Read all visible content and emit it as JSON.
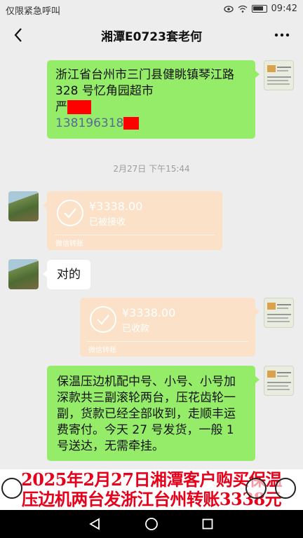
{
  "status_bar": {
    "carrier_text": "仅限紧急呼叫",
    "time": "09:42"
  },
  "header": {
    "title": "湘潭E0723套老何"
  },
  "messages": {
    "address": {
      "line1": "浙江省台州市三门县健眺镇琴江路",
      "line2": "328 号忆角园超市",
      "name_prefix": "严",
      "phone_prefix": "138196318"
    },
    "timestamp": "2月27日 下午15:44",
    "transfer_received_by_other": {
      "amount": "¥3338.00",
      "status": "已被接收",
      "footer": "微信转账"
    },
    "reply": "对的",
    "transfer_received_by_self": {
      "amount": "¥3338.00",
      "status": "已收款",
      "footer": "微信转账"
    },
    "notice": "保温压边机配中号、小号、小号加深款共三副滚轮两台，压花齿轮一副，货款已经全部收到，走顺丰运费寄付。今天 27 号发货，一般 1 号送达，无需牵挂。"
  },
  "caption": {
    "line1": "2025年2月27日湘潭客户购买保温",
    "line2": "压边机两台发浙江台州转账3338元"
  },
  "colors": {
    "background": "#ededed",
    "green_bubble": "#95ec69",
    "transfer_card": "#fbe1c8",
    "caption_red": "#e8001a",
    "phone_link": "#576b95"
  }
}
